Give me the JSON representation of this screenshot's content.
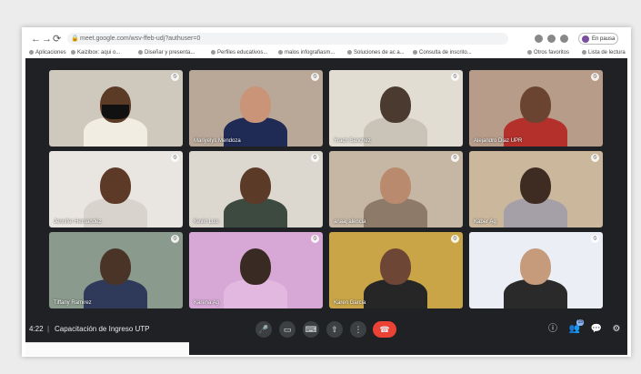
{
  "browser": {
    "url": "meet.google.com/wsv-ffeb-udj?authuser=0",
    "profile_label": "En pausa",
    "nav": {
      "back": "←",
      "forward": "→",
      "reload": "⟳"
    }
  },
  "bookmarks": [
    "Aplicaciones",
    "Kaizibox: aqui o...",
    "Diseñar y presenta...",
    "Perfiles educativos...",
    "malos infografiasm...",
    "Soluciones de ac a...",
    "Consulta de inscrito...",
    "Otros favoritos",
    "Lista de lectura"
  ],
  "participants": [
    {
      "name": "",
      "bg": "#cfc9bd",
      "skin": "#5b3a26",
      "shirt": "#f1ede3",
      "mask": true
    },
    {
      "name": "Mariyelys Mendoza",
      "bg": "#b9a898",
      "skin": "#c99478",
      "shirt": "#1f2a55",
      "mask": false
    },
    {
      "name": "Yrach Sanchez",
      "bg": "#e2ddd3",
      "skin": "#4a3a30",
      "shirt": "#c9c3b8",
      "mask": false
    },
    {
      "name": "Alejandro Diaz UPR",
      "bg": "#b89c8a",
      "skin": "#6a4331",
      "shirt": "#b4312b",
      "mask": false
    },
    {
      "name": "Jennifer Hernandez",
      "bg": "#e9e5e0",
      "skin": "#5c3a27",
      "shirt": "#d8d3cc",
      "mask": false
    },
    {
      "name": "Kevin Luis",
      "bg": "#dcd8d0",
      "skin": "#5b3a28",
      "shirt": "#3d4a3f",
      "mask": false
    },
    {
      "name": "anaaj alencia",
      "bg": "#c6b6a4",
      "skin": "#b98a6d",
      "shirt": "#8e7a68",
      "mask": false
    },
    {
      "name": "Kaber Ag",
      "bg": "#cbb79c",
      "skin": "#3e2b22",
      "shirt": "#a5a0a8",
      "mask": false
    },
    {
      "name": "Tiffany Ramirez",
      "bg": "#8a9a8c",
      "skin": "#4a3428",
      "shirt": "#2f3a5a",
      "mask": false
    },
    {
      "name": "Karena Ag",
      "bg": "#d7a8d6",
      "skin": "#3a2a24",
      "shirt": "#e2b8e0",
      "mask": false
    },
    {
      "name": "Karen Garcia",
      "bg": "#c9a548",
      "skin": "#6e4636",
      "shirt": "#262626",
      "mask": false
    },
    {
      "name": "",
      "bg": "#eceef5",
      "skin": "#c69b7b",
      "shirt": "#2a2a2a",
      "mask": false
    }
  ],
  "meeting": {
    "time": "4:22",
    "separator": "|",
    "name": "Capacitación de Ingreso UTP"
  },
  "controls": {
    "mic": "🎤",
    "camera": "▭",
    "captions": "⌨",
    "present": "⇧",
    "more": "⋮",
    "end_call": "☎"
  },
  "right_controls": {
    "info": "ⓘ",
    "people": "👥",
    "people_count": "15",
    "chat": "💬",
    "activities": "⚙"
  },
  "colors": {
    "meet_bg": "#202124",
    "end_call": "#ea4335",
    "control_bg": "#3c4043"
  }
}
